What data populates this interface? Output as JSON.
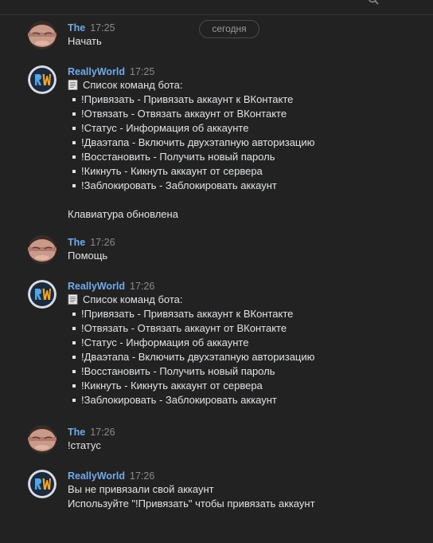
{
  "date_separator": "сегодня",
  "messages": [
    {
      "author": "The",
      "time": "17:25",
      "lines": [
        "Начать"
      ]
    },
    {
      "author": "ReallyWorld",
      "time": "17:25",
      "title": "Список команд бота:",
      "items": [
        "!Привязать - Привязать аккаунт к ВКонтакте",
        "!Отвязать - Отвязать аккаунт от ВКонтакте",
        "!Статус - Информация об аккаунте",
        "!Двaэтапа - Включить двухэтапную авторизацию",
        "!Восстановить - Получить новый пароль",
        "!Кикнуть - Кикнуть аккаунт от сервера",
        "!Заблокировать - Заблокировать аккаунт"
      ],
      "footer": "Клавиатура обновлена"
    },
    {
      "author": "The",
      "time": "17:26",
      "lines": [
        "Помощь"
      ]
    },
    {
      "author": "ReallyWorld",
      "time": "17:26",
      "title": "Список команд бота:",
      "items": [
        "!Привязать - Привязать аккаунт к ВКонтакте",
        "!Отвязать - Отвязать аккаунт от ВКонтакте",
        "!Статус - Информация об аккаунте",
        "!Двaэтапа - Включить двухэтапную авторизацию",
        "!Восстановить - Получить новый пароль",
        "!Кикнуть - Кикнуть аккаунт от сервера",
        "!Заблокировать - Заблокировать аккаунт"
      ]
    },
    {
      "author": "The",
      "time": "17:26",
      "lines": [
        "!статус"
      ]
    },
    {
      "author": "ReallyWorld",
      "time": "17:26",
      "lines": [
        "Вы не привязали свой аккаунт",
        "Используйте \"!Привязать\" чтобы привязать аккаунт"
      ]
    }
  ],
  "colors": {
    "background": "#222222",
    "author": "#71aaeb",
    "text": "#e1e3e6",
    "time": "#8b8b8b"
  },
  "icons": {
    "user_avatar": "user-face-avatar",
    "bot_avatar": "reallyworld-logo-avatar",
    "list_title": "page-with-curl-icon"
  }
}
